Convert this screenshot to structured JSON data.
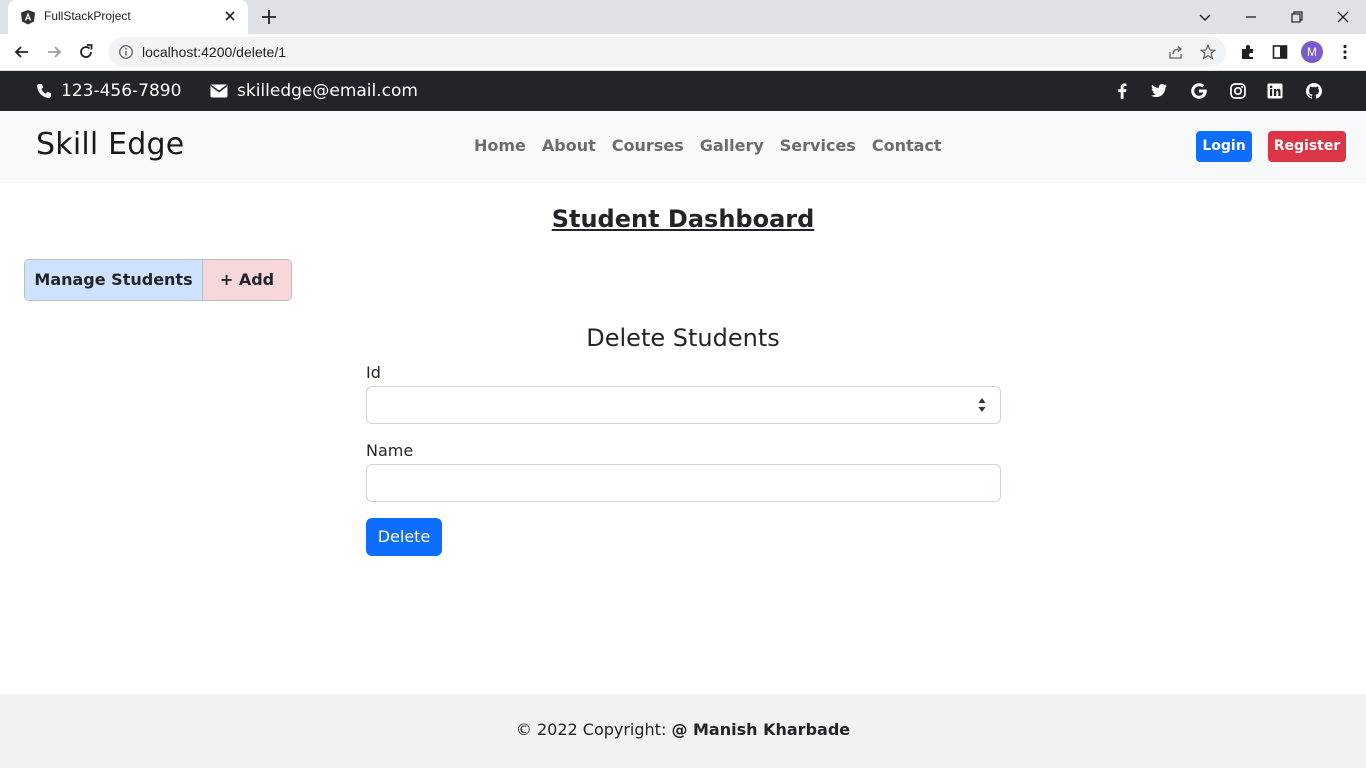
{
  "browser": {
    "tab_title": "FullStackProject",
    "url": "localhost:4200/delete/1",
    "profile_initial": "M"
  },
  "topbar": {
    "phone": "123-456-7890",
    "email": "skilledge@email.com",
    "social_icons": [
      "facebook-icon",
      "twitter-icon",
      "google-icon",
      "instagram-icon",
      "linkedin-icon",
      "github-icon"
    ]
  },
  "navbar": {
    "brand": "Skill Edge",
    "links": [
      "Home",
      "About",
      "Courses",
      "Gallery",
      "Services",
      "Contact"
    ],
    "login_label": "Login",
    "register_label": "Register"
  },
  "main": {
    "dashboard_title": "Student Dashboard",
    "manage_label": "Manage Students",
    "add_label": "+ Add",
    "form_title": "Delete Students",
    "id_label": "Id",
    "id_value": "",
    "name_label": "Name",
    "name_value": "",
    "delete_label": "Delete"
  },
  "footer": {
    "copyright": "© 2022 Copyright:",
    "author": "@ Manish Kharbade"
  },
  "colors": {
    "primary": "#0d6efd",
    "danger": "#dc3545",
    "dark": "#212529",
    "manage_bg": "#cfe2ff",
    "add_bg": "#f8d7da"
  }
}
